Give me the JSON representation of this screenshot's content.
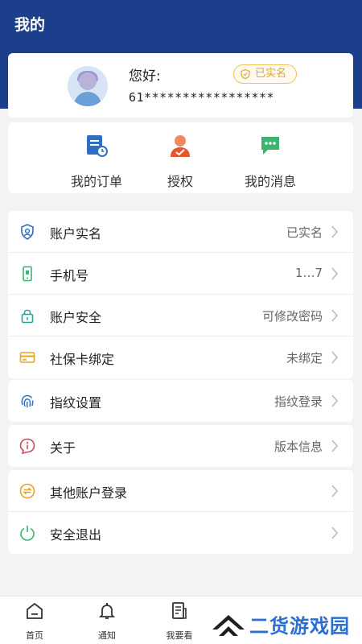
{
  "header": {
    "title": "我的"
  },
  "profile": {
    "greeting": "您好:",
    "verified_label": "已实名",
    "phone_masked": "61*****************"
  },
  "quick_actions": [
    {
      "label": "我的订单",
      "icon": "order-icon"
    },
    {
      "label": "授权",
      "icon": "authorize-icon"
    },
    {
      "label": "我的消息",
      "icon": "message-icon"
    }
  ],
  "menu": {
    "group1": [
      {
        "label": "账户实名",
        "value": "已实名",
        "icon": "shield-icon"
      },
      {
        "label": "手机号",
        "value": "1…7",
        "icon": "phone-icon"
      },
      {
        "label": "账户安全",
        "value": "可修改密码",
        "icon": "lock-icon"
      },
      {
        "label": "社保卡绑定",
        "value": "未绑定",
        "icon": "card-icon"
      }
    ],
    "group2": [
      {
        "label": "指纹设置",
        "value": "指纹登录",
        "icon": "fingerprint-icon"
      }
    ],
    "group3": [
      {
        "label": "关于",
        "value": "版本信息",
        "icon": "info-icon"
      }
    ],
    "group4": [
      {
        "label": "其他账户登录",
        "value": "",
        "icon": "switch-account-icon"
      },
      {
        "label": "安全退出",
        "value": "",
        "icon": "power-icon"
      }
    ]
  },
  "tabbar": [
    {
      "label": "首页",
      "icon": "home-icon"
    },
    {
      "label": "通知",
      "icon": "bell-icon"
    },
    {
      "label": "我要看",
      "icon": "document-icon"
    }
  ],
  "watermark": {
    "text": "二货游戏园"
  },
  "colors": {
    "header": "#1c3f8c",
    "accent_gold": "#e0a52e",
    "watermark_blue": "#2c6fd1"
  }
}
